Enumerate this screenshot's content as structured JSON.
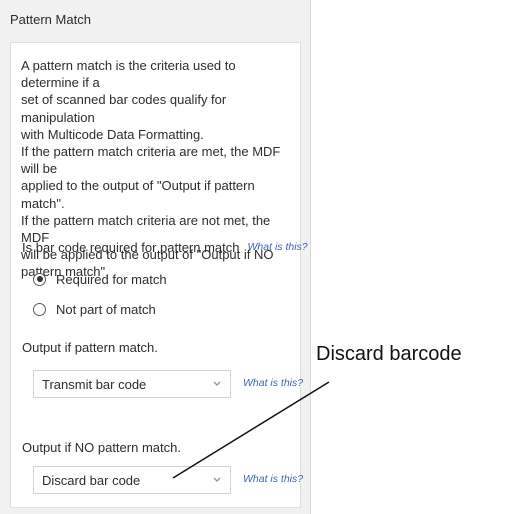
{
  "panel": {
    "title": "Pattern Match",
    "description_lines": [
      "A pattern match is the criteria used to determine if a",
      "set of scanned bar codes qualify for manipulation",
      "with Multicode Data Formatting.",
      "If the pattern match criteria are met, the MDF will be",
      "applied to the output of \"Output if pattern match\".",
      "If the pattern match criteria are not met, the MDF",
      "will be applied to the output of \"Output if NO",
      "pattern match\"."
    ],
    "required_question": {
      "label": "Is bar code required for pattern match",
      "help": "What is this?"
    },
    "radio_options": [
      {
        "label": "Required for match",
        "selected": true
      },
      {
        "label": "Not part of match",
        "selected": false
      }
    ],
    "output_match": {
      "label": "Output if pattern match.",
      "value": "Transmit bar code",
      "help": "What is this?"
    },
    "output_no_match": {
      "label": "Output if NO pattern match.",
      "value": "Discard bar code",
      "help": "What is this?"
    }
  },
  "annotation": {
    "text": "Discard barcode"
  },
  "colors": {
    "panel_bg": "#f1f1f1",
    "link": "#3e63b4",
    "text": "#2d2d2d"
  },
  "icons": {
    "select_arrow": "chevron-down-icon"
  }
}
